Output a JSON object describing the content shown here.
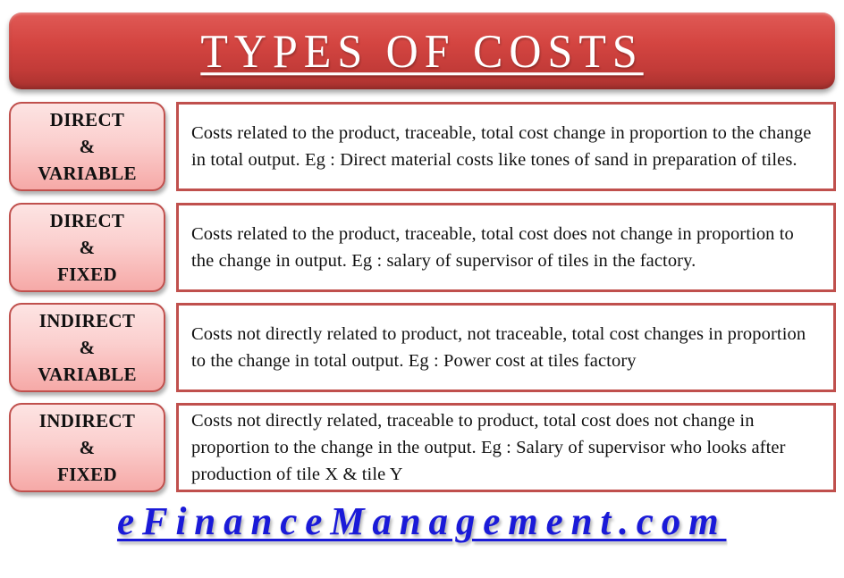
{
  "title": "TYPES OF COSTS",
  "colors": {
    "title_bar": "#d44541",
    "label_border": "#c0504d",
    "label_fill_top": "#fde4e3",
    "label_fill_bottom": "#f6a9a7",
    "desc_border": "#c0504d",
    "footer_link": "#1a1ad8"
  },
  "cost_types": [
    {
      "label_lines": [
        "DIRECT",
        "&",
        "VARIABLE"
      ],
      "description": "Costs related to the product, traceable, total cost change in proportion to the change in total output. Eg : Direct material costs like tones of sand in preparation of tiles."
    },
    {
      "label_lines": [
        "DIRECT",
        "&",
        "FIXED"
      ],
      "description": "Costs related to the product, traceable, total cost does not change in proportion to the change in output. Eg : salary of supervisor of tiles in the factory."
    },
    {
      "label_lines": [
        "INDIRECT",
        "&",
        "VARIABLE"
      ],
      "description": "Costs not directly related to product, not traceable, total cost changes in proportion to the change in total output. Eg : Power cost at tiles factory"
    },
    {
      "label_lines": [
        "INDIRECT",
        "&",
        "FIXED"
      ],
      "description": "Costs not directly related, traceable to product, total cost does not change in proportion to the change in the output. Eg : Salary of supervisor who looks after production of tile X & tile Y"
    }
  ],
  "footer": {
    "site_name": "eFinanceManagement.com"
  }
}
